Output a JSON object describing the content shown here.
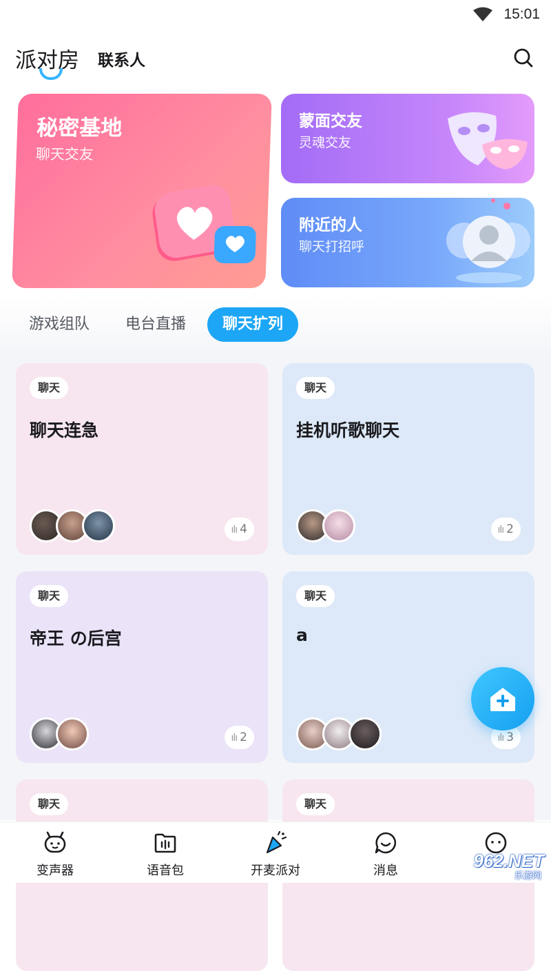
{
  "status_bar": {
    "time": "15:01"
  },
  "header": {
    "tab_party": "派对房",
    "tab_contacts": "联系人"
  },
  "banners": [
    {
      "title": "秘密基地",
      "subtitle": "聊天交友"
    },
    {
      "title": "蒙面交友",
      "subtitle": "灵魂交友"
    },
    {
      "title": "附近的人",
      "subtitle": "聊天打招呼"
    }
  ],
  "categories": [
    {
      "label": "游戏组队",
      "active": false
    },
    {
      "label": "电台直播",
      "active": false
    },
    {
      "label": "聊天扩列",
      "active": true
    }
  ],
  "rooms": [
    {
      "tag": "聊天",
      "name": "聊天连急",
      "count": "4"
    },
    {
      "tag": "聊天",
      "name": "挂机听歌聊天",
      "count": "2"
    },
    {
      "tag": "聊天",
      "name": "帝王 の后宫",
      "count": "2"
    },
    {
      "tag": "聊天",
      "name": "a",
      "count": "3"
    },
    {
      "tag": "聊天",
      "name": "",
      "count": ""
    },
    {
      "tag": "聊天",
      "name": "",
      "count": ""
    }
  ],
  "bottom_nav": [
    {
      "label": "变声器",
      "icon": "robot-face-icon"
    },
    {
      "label": "语音包",
      "icon": "folder-voice-icon"
    },
    {
      "label": "开麦派对",
      "icon": "party-popper-icon"
    },
    {
      "label": "消息",
      "icon": "chat-bubble-icon"
    },
    {
      "label": "",
      "icon": "profile-face-icon"
    }
  ],
  "watermark": {
    "text": "962.NET",
    "sub": "乐游网"
  },
  "colors": {
    "accent": "#1ca6f5",
    "pink_card": "#f7e6ef",
    "blue_card": "#dde9f8",
    "purple_card": "#ebe3f8"
  }
}
